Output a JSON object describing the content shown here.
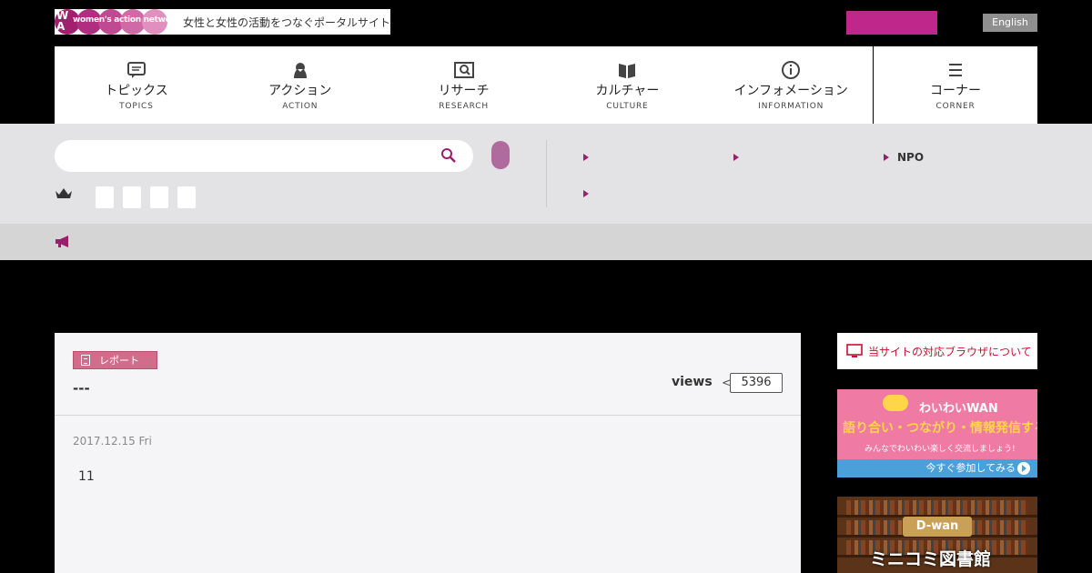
{
  "header": {
    "logo_text": "women's action network",
    "tagline": "女性と女性の活動をつなぐポータルサイト",
    "english_label": "English",
    "pink_button_color": "#c0278b"
  },
  "nav": {
    "items": [
      {
        "jp": "トピックス",
        "en": "TOPICS",
        "icon": "speech-bubble-icon"
      },
      {
        "jp": "アクション",
        "en": "ACTION",
        "icon": "person-icon"
      },
      {
        "jp": "リサーチ",
        "en": "RESEARCH",
        "icon": "magnifier-book-icon"
      },
      {
        "jp": "カルチャー",
        "en": "CULTURE",
        "icon": "open-book-icon"
      },
      {
        "jp": "インフォメーション",
        "en": "INFORMATION",
        "icon": "info-icon"
      },
      {
        "jp": "コーナー",
        "en": "CORNER",
        "icon": "hamburger-icon"
      }
    ]
  },
  "search": {
    "placeholder": "",
    "icon": "search-icon"
  },
  "quicklinks": {
    "npo_label": "NPO"
  },
  "article": {
    "category": "レポート",
    "title": "---",
    "views_label": "views",
    "views_count": "5396",
    "date": "2017.12.15 Fri",
    "body": "11"
  },
  "sidebar": {
    "browser_notice": "当サイトの対応ブラウザについて",
    "waiwai": {
      "name": "わいわいWAN",
      "headline": "語り合い・つながり・情報発信する場",
      "sub": "みんなでわいわい楽しく交流しましょう!",
      "cta": "今すぐ参加してみる"
    },
    "dwan": {
      "name": "D-wan",
      "title": "ミニコミ図書館"
    }
  },
  "colors": {
    "accent": "#96206c",
    "badge": "#d16c8a",
    "band": "#e3e3e5"
  }
}
